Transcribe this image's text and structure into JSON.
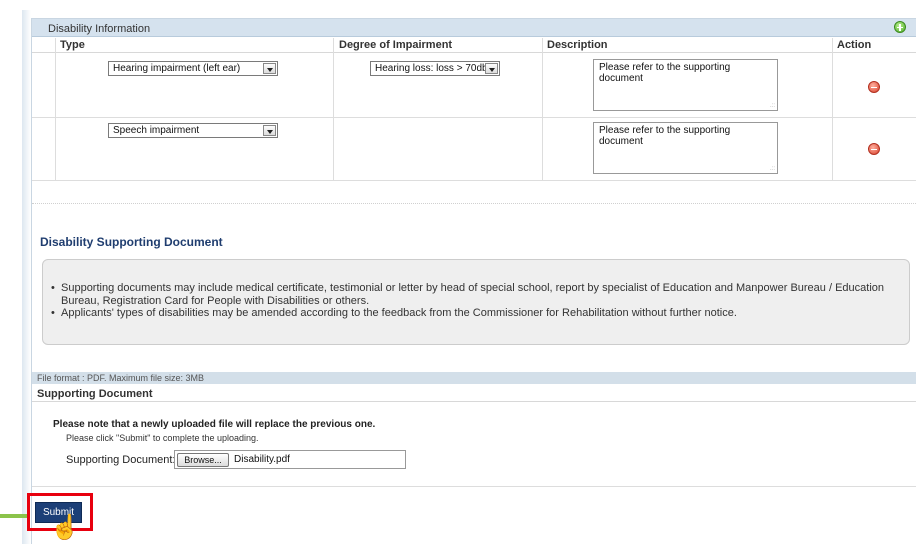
{
  "disability_info": {
    "section_title": "Disability Information",
    "columns": {
      "type": "Type",
      "degree": "Degree of Impairment",
      "description": "Description",
      "action": "Action"
    },
    "rows": [
      {
        "type": "Hearing impairment (left ear)",
        "degree": "Hearing loss: loss > 70db",
        "description": "Please refer to the supporting document"
      },
      {
        "type": "Speech impairment",
        "degree": "",
        "description": "Please refer to the supporting document"
      }
    ]
  },
  "supporting_doc": {
    "title": "Disability Supporting Document",
    "notes": [
      "Supporting documents may include medical certificate, testimonial or letter by head of special school, report by specialist of Education and Manpower Bureau / Education Bureau, Registration Card for People with Disabilities or others.",
      "Applicants' types of disabilities may be amended according to the feedback from the Commissioner for Rehabilitation without further notice."
    ],
    "file_format": "File format : PDF. Maximum file size: 3MB",
    "upload_head": "Supporting Document",
    "newfile_note": "Please note that a newly uploaded file will replace the previous one.",
    "click_note": "Please click \"Submit\" to complete the uploading.",
    "field_label": "Supporting Document:",
    "browse_label": "Browse...",
    "file_name": "Disability.pdf"
  },
  "submit_label": "Submit",
  "icons": {
    "add": "add-circle-icon",
    "remove": "remove-circle-icon",
    "cursor": "hand-pointer-icon"
  },
  "colors": {
    "header_bg": "#d5e2ee",
    "title_blue": "#1f3d6f",
    "submit_bg": "#1c3f77",
    "highlight_red": "#e8000e",
    "hint_green": "#8bc34a"
  }
}
